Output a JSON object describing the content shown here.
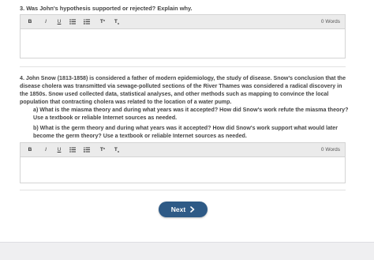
{
  "q3": {
    "title": "3. Was John's hypothesis supported or rejected? Explain why.",
    "toolbar": {
      "bold": "B",
      "italic": "I",
      "underline": "U",
      "superscript": "T",
      "subscript": "T",
      "word_count": "0 Words"
    }
  },
  "q4": {
    "intro": "4. John Snow (1813-1858) is considered a father of modern epidemiology, the study of disease. Snow's conclusion that the disease cholera was transmitted via sewage-polluted sections of the River Thames was considered a radical discovery in the 1850s. Snow used collected data, statistical analyses, and other methods such as mapping to convince the local population that contracting cholera was related to the location of a water pump.",
    "part_a": "a) What is the miasma theory and during what years was it accepted? How did Snow's work refute the miasma theory? Use a textbook or reliable Internet sources as needed.",
    "part_b": "b) What is the germ theory and during what years was it accepted? How did Snow's work support what would later become the germ theory? Use a textbook or reliable Internet sources as needed.",
    "toolbar": {
      "bold": "B",
      "italic": "I",
      "underline": "U",
      "superscript": "T",
      "subscript": "T",
      "word_count": "0 Words"
    }
  },
  "nav": {
    "next_label": "Next"
  }
}
